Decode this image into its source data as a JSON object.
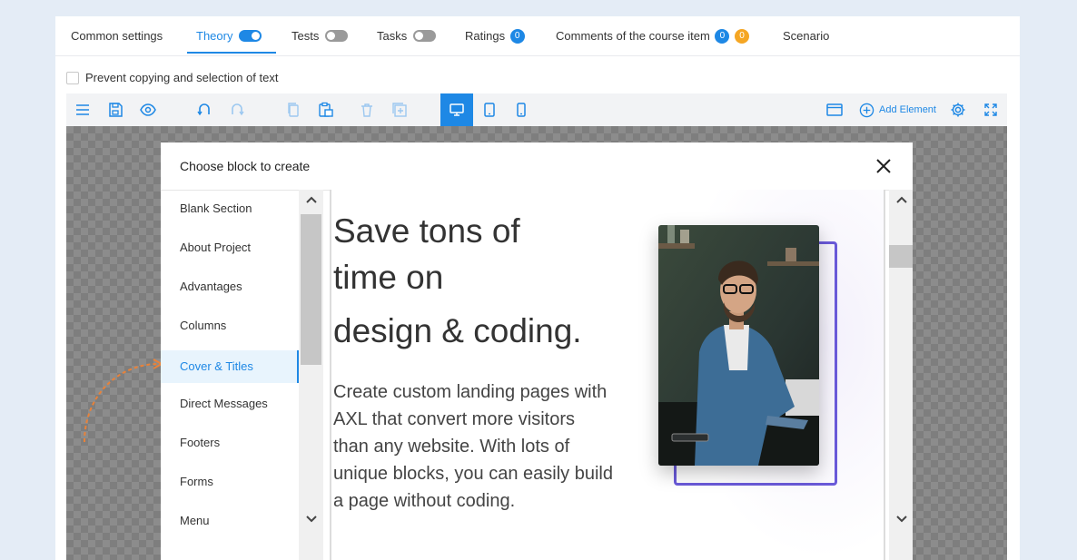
{
  "tabs": [
    {
      "label": "Common settings"
    },
    {
      "label": "Theory",
      "toggle": "on"
    },
    {
      "label": "Tests",
      "toggle": "off"
    },
    {
      "label": "Tasks",
      "toggle": "off"
    },
    {
      "label": "Ratings",
      "badge": "0"
    },
    {
      "label": "Comments of the course item",
      "badges": [
        "0",
        "0"
      ]
    },
    {
      "label": "Scenario"
    }
  ],
  "prevent_copy": {
    "label": "Prevent copying and selection of text",
    "checked": false
  },
  "toolbar": {
    "add_element_label": "Add Element",
    "active_device": "desktop",
    "accent_color": "#1e88e5",
    "icons": [
      "menu-icon",
      "save-icon",
      "eye-icon",
      "undo-icon",
      "redo-icon",
      "copy-icon",
      "paste-icon",
      "trash-icon",
      "duplicate-icon",
      "desktop-icon",
      "tablet-icon",
      "mobile-icon",
      "window-icon",
      "add-circle-icon",
      "gear-icon",
      "fullscreen-icon"
    ]
  },
  "modal": {
    "title": "Choose block to create",
    "categories": [
      {
        "label": "Blank Section"
      },
      {
        "label": "About Project"
      },
      {
        "label": "Advantages"
      },
      {
        "label": "Columns"
      },
      {
        "label": "Cover & Titles",
        "active": true
      },
      {
        "label": "Direct Messages"
      },
      {
        "label": "Footers"
      },
      {
        "label": "Forms"
      },
      {
        "label": "Menu"
      }
    ],
    "preview": {
      "title_lines": [
        "Save tons of",
        "time on",
        "design & coding."
      ],
      "text": "Create custom landing pages with AXL that convert more visitors than any website. With lots of unique blocks, you can easily build a page without coding.",
      "frame_color": "#6a5ad9"
    }
  }
}
